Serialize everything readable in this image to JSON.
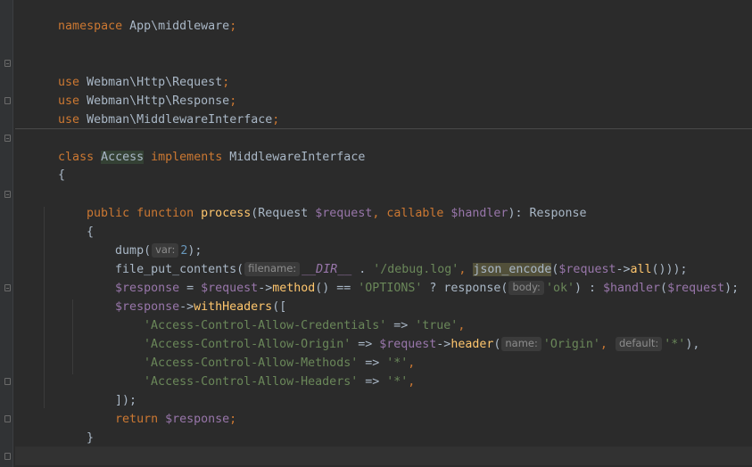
{
  "editor": {
    "language": "php",
    "theme_colors": {
      "background": "#2b2b2b",
      "keyword": "#cc7832",
      "function": "#ffc66d",
      "variable": "#9876aa",
      "string": "#6a8759",
      "number": "#6897bb",
      "text": "#a9b7c6"
    },
    "lines": {
      "l1": {
        "kw": "namespace",
        "name": " App\\middleware",
        "semi": ";"
      },
      "l4": {
        "kw": "use",
        "name": " Webman\\Http\\Request",
        "semi": ";"
      },
      "l5": {
        "kw": "use",
        "name": " Webman\\Http\\Response",
        "semi": ";"
      },
      "l6": {
        "kw": "use",
        "name": " Webman\\MiddlewareInterface",
        "semi": ";"
      },
      "l8": {
        "kw1": "class",
        "cls": "Access",
        "kw2": "implements",
        "iface": " MiddlewareInterface"
      },
      "l9": {
        "text": "{"
      },
      "l11": {
        "kw1": "public",
        "kw2": "function",
        "fn": "process",
        "p_open": "(",
        "t1": "Request ",
        "v1": "$request",
        "comma1": ", ",
        "kw3": "callable",
        "v2": " $handler",
        "p_close": "): Response"
      },
      "l12": {
        "text": "{"
      },
      "l13": {
        "fn": "dump(",
        "hint": "var:",
        "num": "2",
        "end": ");"
      },
      "l14": {
        "fn": "file_put_contents(",
        "hint": "filename:",
        "cst": "__DIR__",
        "dot": " . ",
        "str": "'/debug.log'",
        "comma": ", ",
        "call": "json_encode",
        "open": "(",
        "v": "$request",
        "arrow": "->",
        "m": "all",
        "end": "()));"
      },
      "l15": {
        "v1": "$response",
        "eq": " = ",
        "v2": "$request",
        "arrow": "->",
        "m": "method",
        "op": "() == ",
        "str1": "'OPTIONS'",
        "tern": " ? ",
        "fn": "response(",
        "hint": "body:",
        "str2": "'ok'",
        "colon": ") : ",
        "v3": "$handler",
        "open": "(",
        "v4": "$request",
        "end": ");"
      },
      "l16": {
        "v": "$response",
        "arrow": "->",
        "m": "withHeaders",
        "open": "(["
      },
      "l17": {
        "str1": "'Access-Control-Allow-Credentials'",
        "op": " => ",
        "str2": "'true'",
        "comma": ","
      },
      "l18": {
        "str1": "'Access-Control-Allow-Origin'",
        "op": " => ",
        "v": "$request",
        "arrow": "->",
        "m": "header",
        "open": "(",
        "hint1": "name:",
        "str2": "'Origin'",
        "comma1": ", ",
        "hint2": "default:",
        "str3": "'*'",
        "end": "),"
      },
      "l19": {
        "str1": "'Access-Control-Allow-Methods'",
        "op": " => ",
        "str2": "'*'",
        "comma": ","
      },
      "l20": {
        "str1": "'Access-Control-Allow-Headers'",
        "op": " => ",
        "str2": "'*'",
        "comma": ","
      },
      "l21": {
        "text": "]);"
      },
      "l22": {
        "kw": "return",
        "v": " $response",
        "semi": ";"
      },
      "l23": {
        "text": "}"
      },
      "l25": {
        "text": "}"
      }
    }
  }
}
